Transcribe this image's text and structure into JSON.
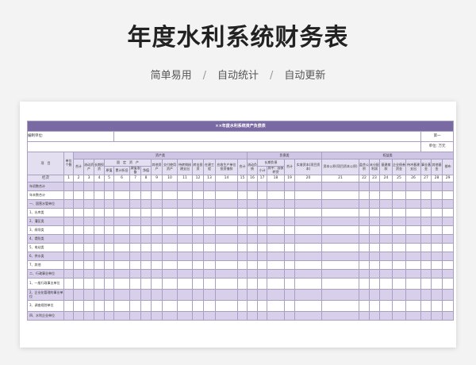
{
  "title": "年度水利系统财务表",
  "subtitle": [
    "简单易用",
    "自动统计",
    "自动更新"
  ],
  "sheet": {
    "table_title": "××年度水利系统资产负债表",
    "meta_label": "编制单位:",
    "unit_cell_a": "第一",
    "unit_cell_b": "单位: 万元",
    "h1": {
      "item": "项　目",
      "unit_count": "单位个数",
      "assets": "资产类",
      "liabilities": "负债类",
      "equity": "权益类"
    },
    "h2": {
      "total_a": "合计",
      "current_assets": "流动资产",
      "lt_invest": "长期投资",
      "fixed_assets": "固　定　资　产",
      "other_assets": "其他资产",
      "deliver_assets": "交付使用资产",
      "transfer": "待转销核建支出",
      "transfer_invest": "转出投资",
      "construction": "在建工程",
      "base_invest": "应收生产单位投资借款",
      "total_b": "合计",
      "current_liab": "流动负债",
      "lt_liab": "长期负债",
      "total_c": "合计",
      "paid_capital": "实收资本(项目资本)",
      "capital_reserve": "资本公积(项目资本公积)",
      "surplus": "盈余公积",
      "undistributed": "未分配利润",
      "fund_balance": "基建拨款",
      "enterprise_fund": "企业债券资金",
      "pending_invest": "待冲基建支出",
      "business_fund": "事业基金",
      "special_fund": "其他基金",
      "special": "拨布"
    },
    "h3": {
      "original": "原值",
      "depreciation": "累计折旧",
      "reduction": "减值准备",
      "net": "净值",
      "subtotal": "小计",
      "including": "其中：国债转贷"
    },
    "col_label": "栏次",
    "col_numbers": [
      "1",
      "2",
      "3",
      "4",
      "5",
      "6",
      "7",
      "8",
      "9",
      "10",
      "11",
      "12",
      "13",
      "14",
      "15",
      "16",
      "17",
      "18",
      "19",
      "20",
      "21",
      "22",
      "23",
      "24",
      "25",
      "26",
      "27",
      "28",
      "29"
    ],
    "rows": [
      "年初数合计",
      "年末数合计",
      "一、国营水管单位",
      "1、水库类",
      "2、灌区类",
      "3、闸坝类",
      "4、堤防类",
      "5、电站类",
      "6、供水类",
      "7、其他",
      "二、行政事业单位",
      "1、一般行政事业单位",
      "2、企业化管理的事业单位",
      "3、调查规划单位",
      "四、水利企业单位"
    ]
  }
}
